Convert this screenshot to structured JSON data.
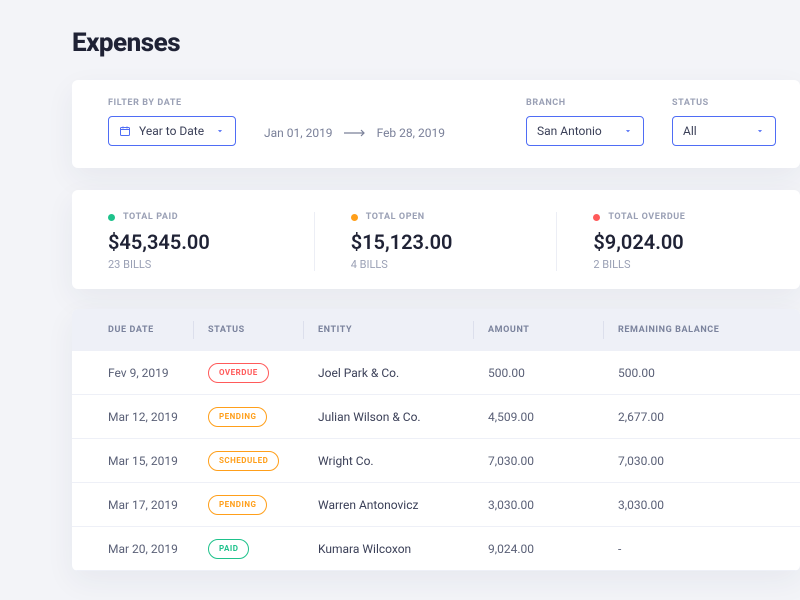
{
  "page": {
    "title": "Expenses"
  },
  "filters": {
    "date_label": "FILTER BY DATE",
    "date_value": "Year to Date",
    "range_start": "Jan 01, 2019",
    "range_end": "Feb 28, 2019",
    "branch_label": "BRANCH",
    "branch_value": "San Antonio",
    "status_label": "STATUS",
    "status_value": "All"
  },
  "summary": [
    {
      "label": "TOTAL PAID",
      "amount": "$45,345.00",
      "sub": "23 BILLS",
      "color": "green"
    },
    {
      "label": "TOTAL OPEN",
      "amount": "$15,123.00",
      "sub": "4 BILLS",
      "color": "orange"
    },
    {
      "label": "TOTAL OVERDUE",
      "amount": "$9,024.00",
      "sub": "2 BILLS",
      "color": "red"
    }
  ],
  "table": {
    "headers": {
      "due_date": "DUE DATE",
      "status": "STATUS",
      "entity": "ENTITY",
      "amount": "AMOUNT",
      "remaining": "REMAINING BALANCE"
    },
    "rows": [
      {
        "due_date": "Fev 9, 2019",
        "status": "OVERDUE",
        "status_class": "overdue",
        "entity": "Joel Park & Co.",
        "amount": "500.00",
        "remaining": "500.00"
      },
      {
        "due_date": "Mar 12, 2019",
        "status": "PENDING",
        "status_class": "pending",
        "entity": "Julian Wilson & Co.",
        "amount": "4,509.00",
        "remaining": "2,677.00"
      },
      {
        "due_date": "Mar 15, 2019",
        "status": "SCHEDULED",
        "status_class": "scheduled",
        "entity": "Wright Co.",
        "amount": "7,030.00",
        "remaining": "7,030.00"
      },
      {
        "due_date": "Mar 17, 2019",
        "status": "PENDING",
        "status_class": "pending",
        "entity": "Warren Antonovicz",
        "amount": "3,030.00",
        "remaining": "3,030.00"
      },
      {
        "due_date": "Mar 20, 2019",
        "status": "PAID",
        "status_class": "paid",
        "entity": "Kumara Wilcoxon",
        "amount": "9,024.00",
        "remaining": "-"
      }
    ]
  }
}
